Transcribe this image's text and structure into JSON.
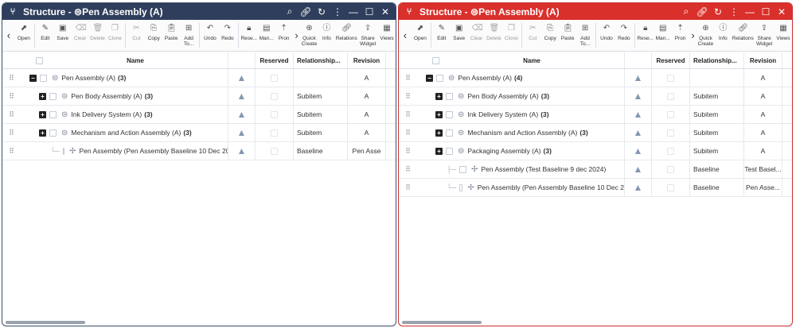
{
  "left": {
    "title": "Structure - ",
    "title_object": "Pen Assembly (A)",
    "toolbar": [
      "Open",
      "Edit",
      "Save",
      "Clear",
      "Delete",
      "Clone",
      "Cut",
      "Copy",
      "Paste",
      "Add To...",
      "Undo",
      "Redo",
      "Rese...",
      "Man...",
      "Pron",
      "Quick Create",
      "Info",
      "Relations",
      "Share Widget",
      "Views"
    ],
    "columns": {
      "name": "Name",
      "reserved": "Reserved",
      "relationship": "Relationship...",
      "revision": "Revision"
    },
    "rows": [
      {
        "label": "Pen Assembly (A)",
        "count": "(3)",
        "rel": "",
        "rev": "A"
      },
      {
        "label": "Pen Body Assembly (A)",
        "count": "(3)",
        "rel": "Subitem",
        "rev": "A"
      },
      {
        "label": "Ink Delivery System (A)",
        "count": "(3)",
        "rel": "Subitem",
        "rev": "A"
      },
      {
        "label": "Mechanism and Action Assembly (A)",
        "count": "(3)",
        "rel": "Subitem",
        "rev": "A"
      },
      {
        "label": "Pen Assembly (Pen Assembly Baseline 10 Dec 20",
        "count": "",
        "rel": "Baseline",
        "rev": "Pen Asse"
      }
    ]
  },
  "right": {
    "title": "Structure - ",
    "title_object": "Pen Assembly (A)",
    "columns": {
      "name": "Name",
      "reserved": "Reserved",
      "relationship": "Relationship...",
      "revision": "Revision"
    },
    "rows": [
      {
        "label": "Pen Assembly (A)",
        "count": "(4)",
        "rel": "",
        "rev": "A"
      },
      {
        "label": "Pen Body Assembly (A)",
        "count": "(3)",
        "rel": "Subitem",
        "rev": "A"
      },
      {
        "label": "Ink Delivery System (A)",
        "count": "(3)",
        "rel": "Subitem",
        "rev": "A"
      },
      {
        "label": "Mechanism and Action Assembly (A)",
        "count": "(3)",
        "rel": "Subitem",
        "rev": "A"
      },
      {
        "label": "Packaging Assembly (A)",
        "count": "(3)",
        "rel": "Subitem",
        "rev": "A"
      },
      {
        "label": "Pen Assembly (Test Baseline 9 dec 2024)",
        "count": "",
        "rel": "Baseline",
        "rev": "Test Basel..."
      },
      {
        "label": "Pen Assembly (Pen Assembly Baseline 10 Dec 2",
        "count": "",
        "rel": "Baseline",
        "rev": "Pen Asse..."
      }
    ]
  }
}
